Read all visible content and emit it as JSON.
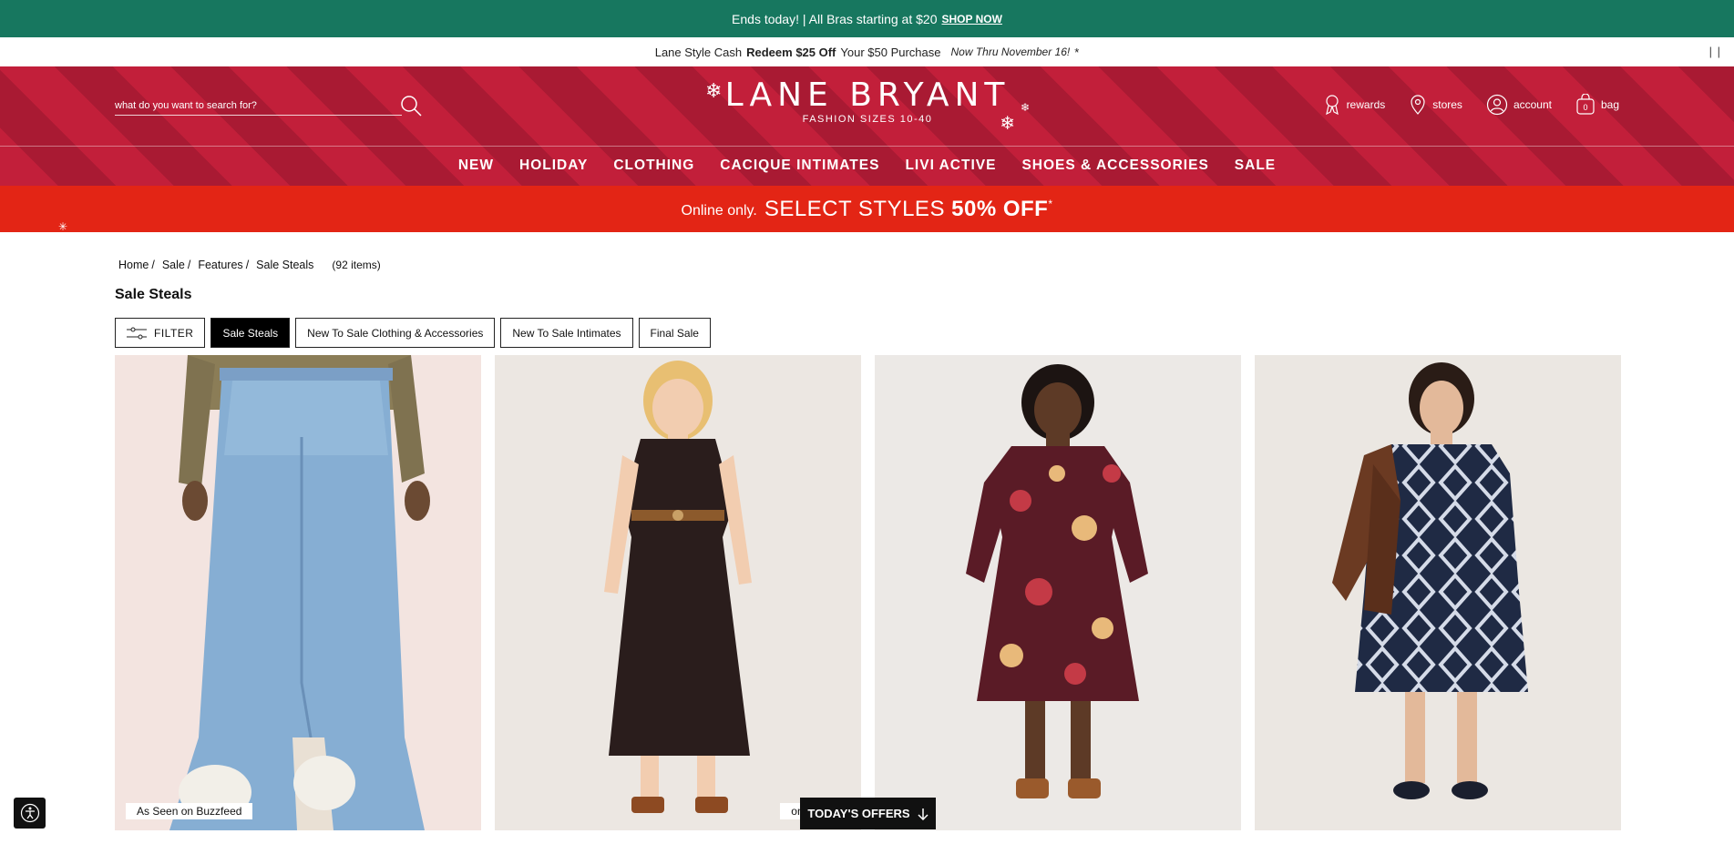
{
  "promo": {
    "text": "Ends today! | All Bras starting at $20",
    "link": "SHOP NOW",
    "bg": "#17775f"
  },
  "cash": {
    "prefix": "Lane Style Cash",
    "bold1": "Redeem $25 Off",
    "mid": "Your $50 Purchase",
    "dates": "Now Thru November 16!",
    "asterisk": "*",
    "pause": "| |"
  },
  "header": {
    "search_placeholder": "what do you want to search for?",
    "logo_name": "LANE BRYANT",
    "logo_tag": "FASHION SIZES 10-40",
    "utils": {
      "rewards": "rewards",
      "stores": "stores",
      "account": "account",
      "bag": "bag",
      "bag_count": "0"
    },
    "nav": [
      "NEW",
      "HOLIDAY",
      "CLOTHING",
      "CACIQUE INTIMATES",
      "LIVI ACTIVE",
      "SHOES & ACCESSORIES",
      "SALE"
    ]
  },
  "sale_bar": {
    "small": "Online only.",
    "big_prefix": "SELECT STYLES",
    "big_bold": "50% OFF",
    "asterisk": "*",
    "bg": "#e32515"
  },
  "breadcrumb": [
    "Home",
    "Sale",
    "Features",
    "Sale Steals"
  ],
  "item_count": "(92 items)",
  "page_title": "Sale Steals",
  "filters": {
    "filter_label": "FILTER",
    "chips": [
      "Sale Steals",
      "New To Sale Clothing & Accessories",
      "New To Sale Intimates",
      "Final Sale"
    ]
  },
  "products": [
    {
      "name": "denim-midi-skirt",
      "badge": "As Seen on Buzzfeed"
    },
    {
      "name": "black-dot-dress",
      "badge": "on Buzzfeed"
    },
    {
      "name": "burgundy-floral-dress",
      "badge": ""
    },
    {
      "name": "navy-geo-print-dress",
      "badge": ""
    }
  ],
  "offers_button": "TODAY'S OFFERS"
}
